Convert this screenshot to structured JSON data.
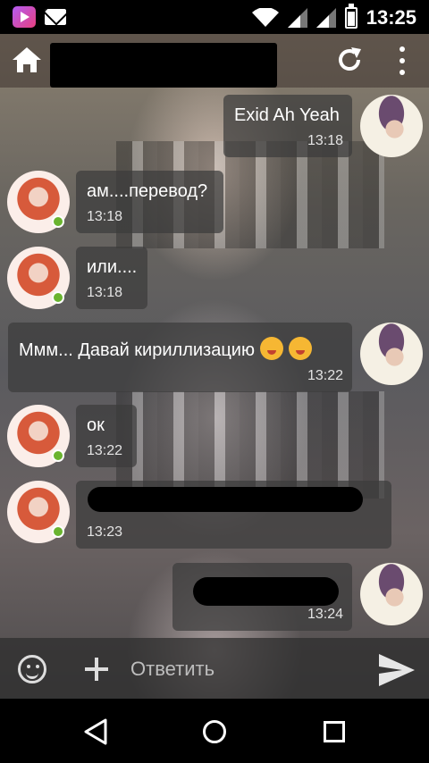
{
  "status_bar": {
    "time": "13:25"
  },
  "toolbar": {
    "title_redacted": true
  },
  "messages": [
    {
      "side": "right",
      "text": "Exid Ah Yeah",
      "time": "13:18"
    },
    {
      "side": "left",
      "text": "ам....перевод?",
      "time": "13:18",
      "online": true
    },
    {
      "side": "left",
      "text": "или....",
      "time": "13:18",
      "online": true
    },
    {
      "side": "right",
      "text": "Ммм... Давай кириллизацию",
      "time": "13:22",
      "emojis": [
        "tongue-out-emoji",
        "wink-emoji"
      ]
    },
    {
      "side": "left",
      "text": "ок",
      "time": "13:22",
      "online": true
    },
    {
      "side": "left",
      "text": "",
      "time": "13:23",
      "online": true,
      "redacted": true
    },
    {
      "side": "right",
      "text": "",
      "time": "13:24",
      "redacted": true
    }
  ],
  "input": {
    "placeholder": "Ответить"
  },
  "colors": {
    "online": "#6ab42f",
    "bubble": "#3c3c3c"
  }
}
